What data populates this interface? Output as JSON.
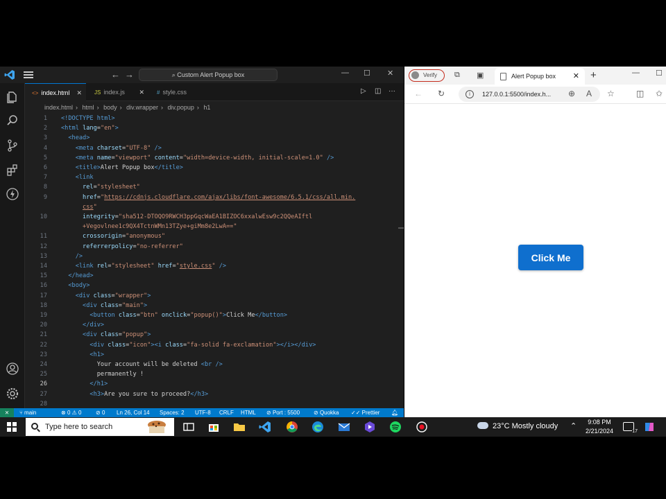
{
  "vscode": {
    "search_text": "Custom Alert Popup box",
    "tabs": [
      {
        "icon": "<>",
        "label": "index.html",
        "active": true
      },
      {
        "icon": "JS",
        "label": "index.js",
        "active": false
      },
      {
        "icon": "#",
        "label": "style.css",
        "active": false
      }
    ],
    "breadcrumb": [
      "index.html",
      "html",
      "body",
      "div.wrapper",
      "div.popup",
      "h1"
    ],
    "code_lines": [
      {
        "n": "1",
        "parts": [
          [
            "t-tag",
            "<!DOCTYPE html>"
          ]
        ]
      },
      {
        "n": "2",
        "parts": [
          [
            "t-tag",
            "<html "
          ],
          [
            "t-attr",
            "lang"
          ],
          [
            "t-txt",
            "="
          ],
          [
            "t-str",
            "\"en\""
          ],
          [
            "t-tag",
            ">"
          ]
        ]
      },
      {
        "n": "3",
        "parts": [
          [
            "t-txt",
            "  "
          ],
          [
            "t-tag",
            "<head>"
          ]
        ]
      },
      {
        "n": "4",
        "parts": [
          [
            "t-txt",
            "    "
          ],
          [
            "t-tag",
            "<meta "
          ],
          [
            "t-attr",
            "charset"
          ],
          [
            "t-txt",
            "="
          ],
          [
            "t-str",
            "\"UTF-8\""
          ],
          [
            "t-tag",
            " />"
          ]
        ]
      },
      {
        "n": "5",
        "parts": [
          [
            "t-txt",
            "    "
          ],
          [
            "t-tag",
            "<meta "
          ],
          [
            "t-attr",
            "name"
          ],
          [
            "t-txt",
            "="
          ],
          [
            "t-str",
            "\"viewport\""
          ],
          [
            "t-attr",
            " content"
          ],
          [
            "t-txt",
            "="
          ],
          [
            "t-str",
            "\"width=device-width, initial-scale=1.0\""
          ],
          [
            "t-tag",
            " />"
          ]
        ]
      },
      {
        "n": "6",
        "parts": [
          [
            "t-txt",
            "    "
          ],
          [
            "t-tag",
            "<title>"
          ],
          [
            "t-txt",
            "Alert Popup box"
          ],
          [
            "t-tag",
            "</title>"
          ]
        ]
      },
      {
        "n": "7",
        "parts": [
          [
            "t-txt",
            "    "
          ],
          [
            "t-tag",
            "<link"
          ]
        ]
      },
      {
        "n": "8",
        "parts": [
          [
            "t-txt",
            "      "
          ],
          [
            "t-attr",
            "rel"
          ],
          [
            "t-txt",
            "="
          ],
          [
            "t-str",
            "\"stylesheet\""
          ]
        ]
      },
      {
        "n": "9",
        "parts": [
          [
            "t-txt",
            "      "
          ],
          [
            "t-attr",
            "href"
          ],
          [
            "t-txt",
            "="
          ],
          [
            "t-str",
            "\""
          ],
          [
            "t-link",
            "https://cdnjs.cloudflare.com/ajax/libs/font-awesome/6.5.1/css/all.min."
          ]
        ]
      },
      {
        "n": "",
        "parts": [
          [
            "t-txt",
            "      "
          ],
          [
            "t-link",
            "css"
          ],
          [
            "t-str",
            "\""
          ]
        ]
      },
      {
        "n": "10",
        "parts": [
          [
            "t-txt",
            "      "
          ],
          [
            "t-attr",
            "integrity"
          ],
          [
            "t-txt",
            "="
          ],
          [
            "t-str",
            "\"sha512-DTOQO9RWCH3ppGqcWaEA1BIZOC6xxalwEsw9c2QQeAIftl"
          ]
        ]
      },
      {
        "n": "",
        "parts": [
          [
            "t-txt",
            "      "
          ],
          [
            "t-str",
            "+Vegovlnee1c9QX4TctnWMn13TZye+giMm8e2LwA==\""
          ]
        ]
      },
      {
        "n": "11",
        "parts": [
          [
            "t-txt",
            "      "
          ],
          [
            "t-attr",
            "crossorigin"
          ],
          [
            "t-txt",
            "="
          ],
          [
            "t-str",
            "\"anonymous\""
          ]
        ]
      },
      {
        "n": "12",
        "parts": [
          [
            "t-txt",
            "      "
          ],
          [
            "t-attr",
            "referrerpolicy"
          ],
          [
            "t-txt",
            "="
          ],
          [
            "t-str",
            "\"no-referrer\""
          ]
        ]
      },
      {
        "n": "13",
        "parts": [
          [
            "t-txt",
            "    "
          ],
          [
            "t-tag",
            "/>"
          ]
        ]
      },
      {
        "n": "14",
        "parts": [
          [
            "t-txt",
            "    "
          ],
          [
            "t-tag",
            "<link "
          ],
          [
            "t-attr",
            "rel"
          ],
          [
            "t-txt",
            "="
          ],
          [
            "t-str",
            "\"stylesheet\""
          ],
          [
            "t-attr",
            " href"
          ],
          [
            "t-txt",
            "="
          ],
          [
            "t-str",
            "\""
          ],
          [
            "t-link",
            "style.css"
          ],
          [
            "t-str",
            "\""
          ],
          [
            "t-tag",
            " />"
          ]
        ]
      },
      {
        "n": "15",
        "parts": [
          [
            "t-txt",
            "  "
          ],
          [
            "t-tag",
            "</head>"
          ]
        ]
      },
      {
        "n": "16",
        "parts": [
          [
            "t-txt",
            "  "
          ],
          [
            "t-tag",
            "<body>"
          ]
        ]
      },
      {
        "n": "17",
        "parts": [
          [
            "t-txt",
            "    "
          ],
          [
            "t-tag",
            "<div "
          ],
          [
            "t-attr",
            "class"
          ],
          [
            "t-txt",
            "="
          ],
          [
            "t-str",
            "\"wrapper\""
          ],
          [
            "t-tag",
            ">"
          ]
        ]
      },
      {
        "n": "18",
        "parts": [
          [
            "t-txt",
            "      "
          ],
          [
            "t-tag",
            "<div "
          ],
          [
            "t-attr",
            "class"
          ],
          [
            "t-txt",
            "="
          ],
          [
            "t-str",
            "\"main\""
          ],
          [
            "t-tag",
            ">"
          ]
        ]
      },
      {
        "n": "19",
        "parts": [
          [
            "t-txt",
            "        "
          ],
          [
            "t-tag",
            "<button "
          ],
          [
            "t-attr",
            "class"
          ],
          [
            "t-txt",
            "="
          ],
          [
            "t-str",
            "\"btn\""
          ],
          [
            "t-attr",
            " onclick"
          ],
          [
            "t-txt",
            "="
          ],
          [
            "t-str",
            "\"popup()\""
          ],
          [
            "t-tag",
            ">"
          ],
          [
            "t-txt",
            "Click Me"
          ],
          [
            "t-tag",
            "</button>"
          ]
        ]
      },
      {
        "n": "20",
        "parts": [
          [
            "t-txt",
            "      "
          ],
          [
            "t-tag",
            "</div>"
          ]
        ]
      },
      {
        "n": "21",
        "parts": [
          [
            "t-txt",
            "      "
          ],
          [
            "t-tag",
            "<div "
          ],
          [
            "t-attr",
            "class"
          ],
          [
            "t-txt",
            "="
          ],
          [
            "t-str",
            "\"popup\""
          ],
          [
            "t-tag",
            ">"
          ]
        ]
      },
      {
        "n": "22",
        "parts": [
          [
            "t-txt",
            "        "
          ],
          [
            "t-tag",
            "<div "
          ],
          [
            "t-attr",
            "class"
          ],
          [
            "t-txt",
            "="
          ],
          [
            "t-str",
            "\"icon\""
          ],
          [
            "t-tag",
            "><i "
          ],
          [
            "t-attr",
            "class"
          ],
          [
            "t-txt",
            "="
          ],
          [
            "t-str",
            "\"fa-solid fa-exclamation\""
          ],
          [
            "t-tag",
            "></i></div>"
          ]
        ]
      },
      {
        "n": "23",
        "parts": [
          [
            "t-txt",
            "        "
          ],
          [
            "t-tag",
            "<h1>"
          ]
        ]
      },
      {
        "n": "24",
        "parts": [
          [
            "t-txt",
            "          Your account will be deleted "
          ],
          [
            "t-tag",
            "<br />"
          ]
        ]
      },
      {
        "n": "25",
        "parts": [
          [
            "t-txt",
            "          permanently !"
          ]
        ]
      },
      {
        "n": "26",
        "parts": [
          [
            "t-txt",
            "        "
          ],
          [
            "t-tag",
            "</h1>"
          ]
        ]
      },
      {
        "n": "27",
        "parts": [
          [
            "t-txt",
            "        "
          ],
          [
            "t-tag",
            "<h3>"
          ],
          [
            "t-txt",
            "Are you sure to proceed?"
          ],
          [
            "t-tag",
            "</h3>"
          ]
        ]
      },
      {
        "n": "28",
        "parts": []
      }
    ],
    "current_line": "26",
    "status": {
      "branch": "main",
      "errors": "0",
      "warnings": "0",
      "ports": "0",
      "position": "Ln 26, Col 14",
      "spaces": "Spaces: 2",
      "encoding": "UTF-8",
      "eol": "CRLF",
      "language": "HTML",
      "port": "Port : 5500",
      "quokka": "Quokka",
      "prettier": "Prettier"
    }
  },
  "browser": {
    "verify_label": "Verify",
    "tab_title": "Alert Popup box",
    "url": "127.0.0.1:5500/index.h...",
    "button_label": "Click Me",
    "button_color": "#0f6fce"
  },
  "taskbar": {
    "search_placeholder": "Type here to search",
    "weather": "23°C  Mostly cloudy",
    "time": "9:08 PM",
    "date": "2/21/2024",
    "notifications": "17"
  }
}
